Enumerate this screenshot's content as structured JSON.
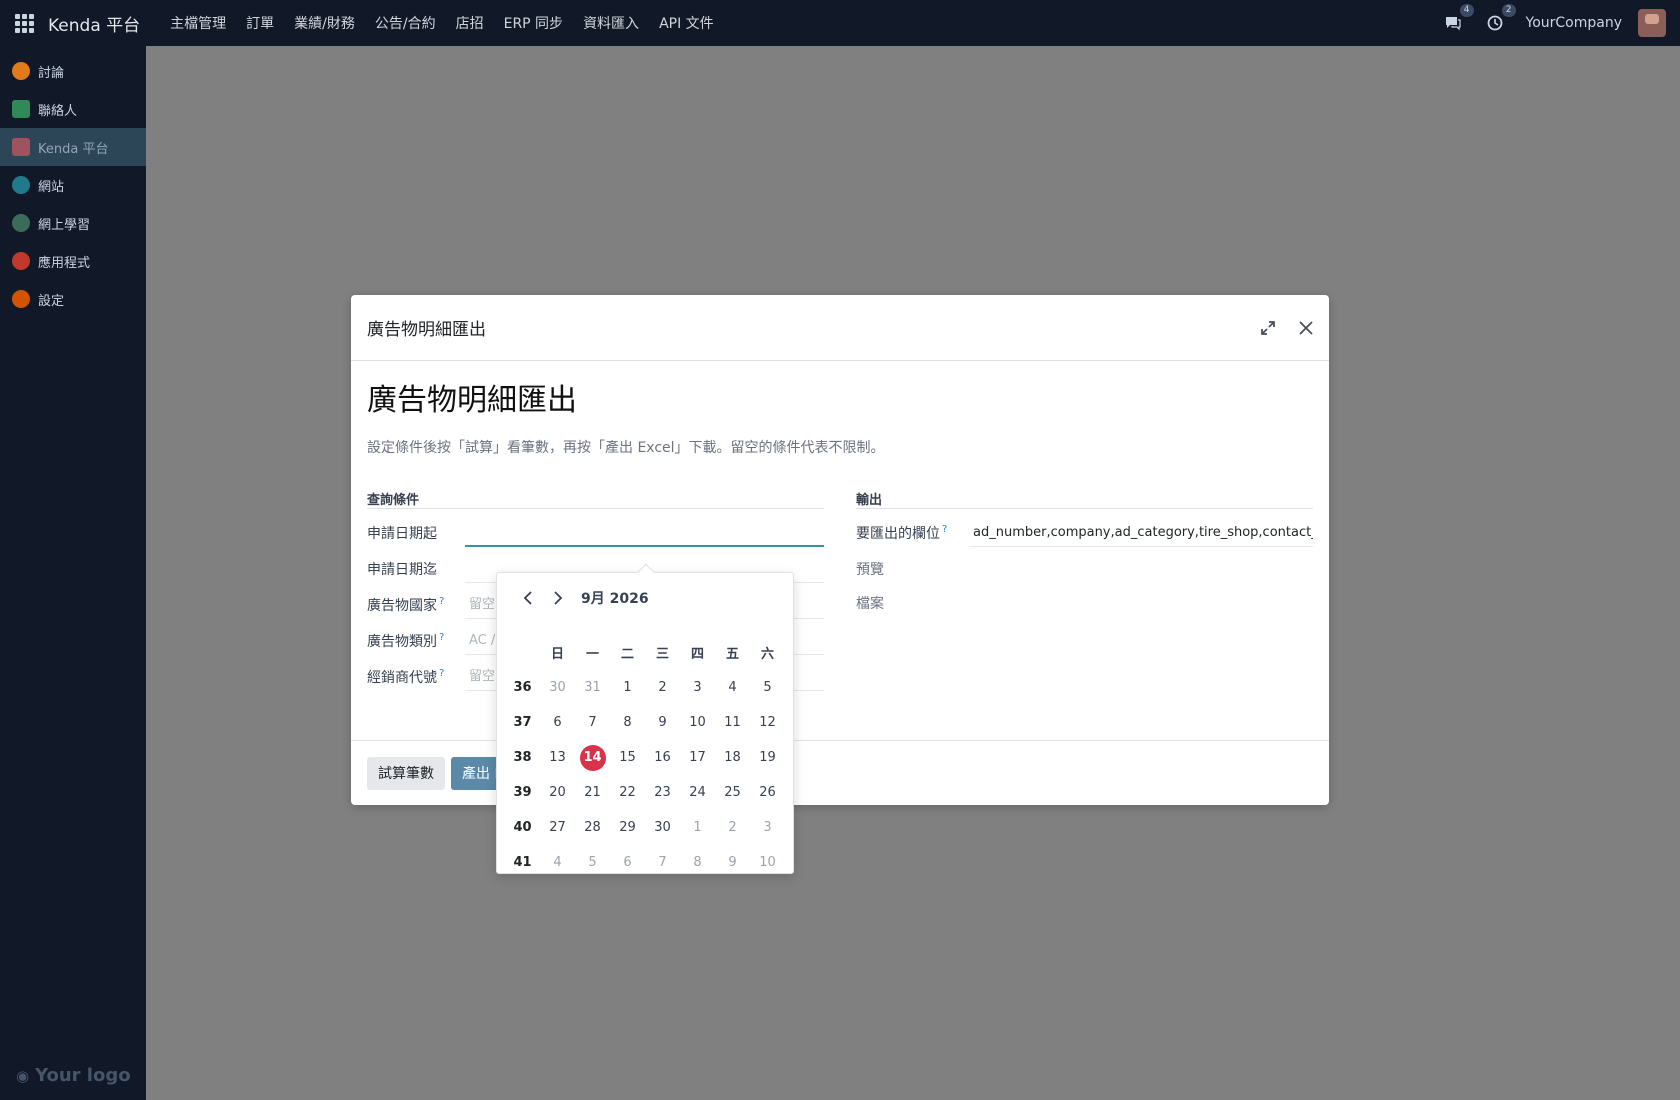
{
  "topbar": {
    "brand": "Kenda 平台",
    "menu": [
      "主檔管理",
      "訂單",
      "業績/財務",
      "公告/合約",
      "店招",
      "ERP 同步",
      "資料匯入",
      "API 文件"
    ],
    "messages_count": "4",
    "activity_count": "2",
    "company": "YourCompany"
  },
  "sidebar": {
    "items": [
      {
        "label": "討論",
        "color": "#e07b1c"
      },
      {
        "label": "聯絡人",
        "color": "#2e8b57"
      },
      {
        "label": "Kenda 平台",
        "color": "#a0525d"
      },
      {
        "label": "網站",
        "color": "#1f7a8c"
      },
      {
        "label": "網上學習",
        "color": "#3b6b5b"
      },
      {
        "label": "應用程式",
        "color": "#c0392b"
      },
      {
        "label": "設定",
        "color": "#d35400"
      }
    ],
    "logo": "Your logo"
  },
  "modal": {
    "header_title": "廣告物明細匯出",
    "form_title": "廣告物明細匯出",
    "description": "設定條件後按「試算」看筆數，再按「產出 Excel」下載。留空的條件代表不限制。",
    "query_group": {
      "title": "查詢條件",
      "fields": [
        {
          "label": "申請日期起",
          "value": "",
          "placeholder": ""
        },
        {
          "label": "申請日期迄",
          "value": "",
          "placeholder": ""
        },
        {
          "label": "廣告物國家",
          "help": "?",
          "value": "",
          "placeholder": "留空"
        },
        {
          "label": "廣告物類別",
          "help": "?",
          "value": "",
          "placeholder": "AC /"
        },
        {
          "label": "經銷商代號",
          "help": "?",
          "value": "",
          "placeholder": "留空"
        }
      ]
    },
    "output_group": {
      "title": "輸出",
      "export_fields_label": "要匯出的欄位",
      "export_fields_help": "?",
      "export_fields_value": "ad_number,company,ad_category,tire_shop,contact_p",
      "preview_label": "預覽",
      "file_label": "檔案"
    },
    "buttons": {
      "estimate": "試算筆數",
      "export": "產出 E"
    }
  },
  "datepicker": {
    "month_label": "9月 2026",
    "weekdays": [
      "日",
      "一",
      "二",
      "三",
      "四",
      "五",
      "六"
    ],
    "weeks": [
      {
        "week": "36",
        "days": [
          {
            "d": "30",
            "o": true
          },
          {
            "d": "31",
            "o": true
          },
          {
            "d": "1"
          },
          {
            "d": "2"
          },
          {
            "d": "3"
          },
          {
            "d": "4"
          },
          {
            "d": "5"
          }
        ]
      },
      {
        "week": "37",
        "days": [
          {
            "d": "6"
          },
          {
            "d": "7"
          },
          {
            "d": "8"
          },
          {
            "d": "9"
          },
          {
            "d": "10"
          },
          {
            "d": "11"
          },
          {
            "d": "12"
          }
        ]
      },
      {
        "week": "38",
        "days": [
          {
            "d": "13"
          },
          {
            "d": "14",
            "today": true
          },
          {
            "d": "15"
          },
          {
            "d": "16"
          },
          {
            "d": "17"
          },
          {
            "d": "18"
          },
          {
            "d": "19"
          }
        ]
      },
      {
        "week": "39",
        "days": [
          {
            "d": "20"
          },
          {
            "d": "21"
          },
          {
            "d": "22"
          },
          {
            "d": "23"
          },
          {
            "d": "24"
          },
          {
            "d": "25"
          },
          {
            "d": "26"
          }
        ]
      },
      {
        "week": "40",
        "days": [
          {
            "d": "27"
          },
          {
            "d": "28"
          },
          {
            "d": "29"
          },
          {
            "d": "30"
          },
          {
            "d": "1",
            "o": true
          },
          {
            "d": "2",
            "o": true
          },
          {
            "d": "3",
            "o": true
          }
        ]
      },
      {
        "week": "41",
        "days": [
          {
            "d": "4",
            "o": true
          },
          {
            "d": "5",
            "o": true
          },
          {
            "d": "6",
            "o": true
          },
          {
            "d": "7",
            "o": true
          },
          {
            "d": "8",
            "o": true
          },
          {
            "d": "9",
            "o": true
          },
          {
            "d": "10",
            "o": true
          }
        ]
      }
    ],
    "today_color": "#d9324a"
  }
}
